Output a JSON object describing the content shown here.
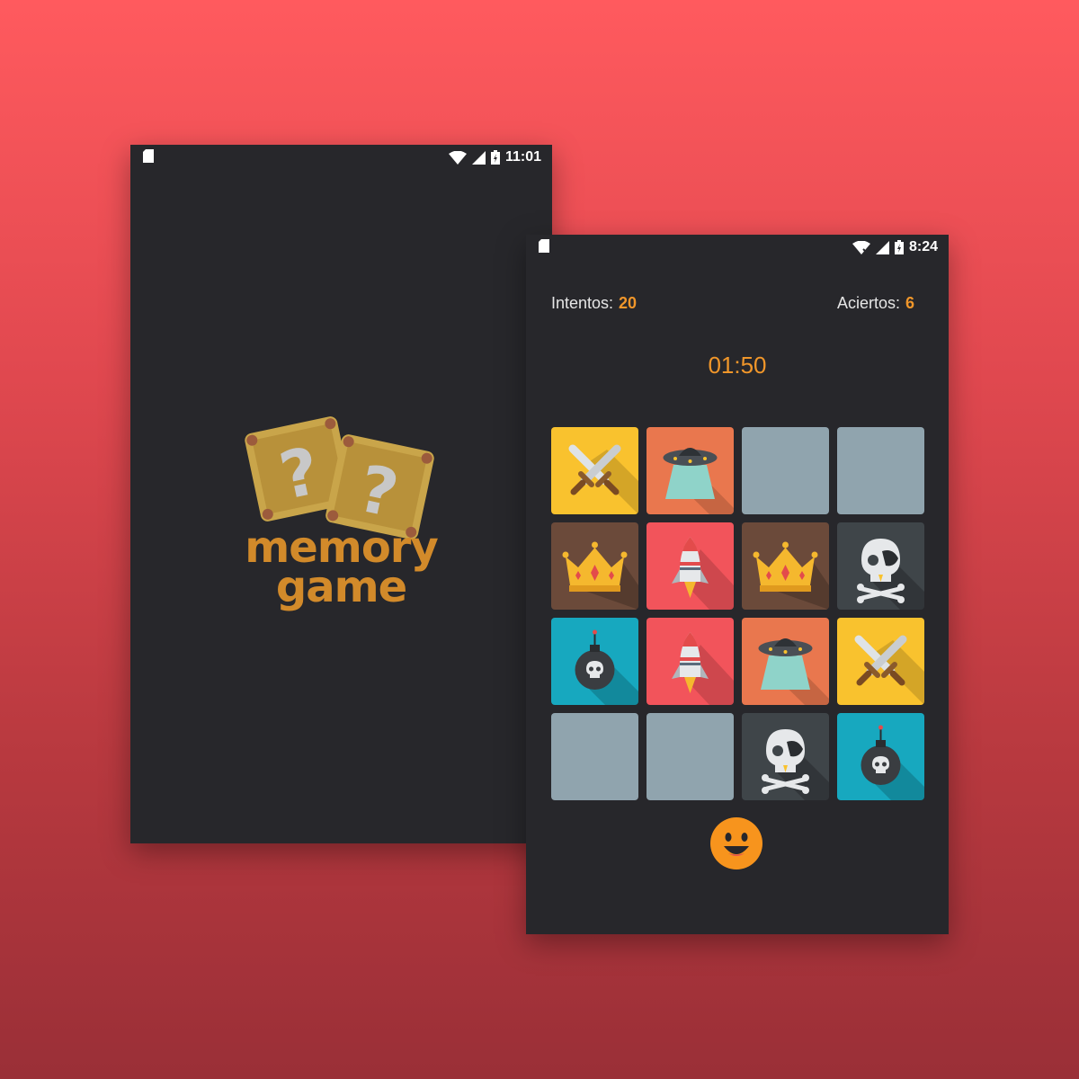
{
  "splash": {
    "status_time": "11:01",
    "logo_line1": "memory",
    "logo_line2": "game"
  },
  "game": {
    "status_time": "8:24",
    "attempts_label": "Intentos:",
    "attempts_value": "20",
    "hits_label": "Aciertos:",
    "hits_value": "6",
    "timer": "01:50",
    "cards": [
      {
        "state": "revealed",
        "icon": "swords-icon",
        "color": "#f9c22e"
      },
      {
        "state": "revealed",
        "icon": "ufo-icon",
        "color": "#e9774e"
      },
      {
        "state": "hidden",
        "icon": "",
        "color": "#90a4ae"
      },
      {
        "state": "hidden",
        "icon": "",
        "color": "#90a4ae"
      },
      {
        "state": "revealed",
        "icon": "crown-icon",
        "color": "#6b4a3a"
      },
      {
        "state": "revealed",
        "icon": "rocket-icon",
        "color": "#f2545b"
      },
      {
        "state": "revealed",
        "icon": "crown-icon",
        "color": "#6b4a3a"
      },
      {
        "state": "revealed",
        "icon": "pirate-skull-icon",
        "color": "#3f4549"
      },
      {
        "state": "revealed",
        "icon": "bomb-icon",
        "color": "#17a8bf"
      },
      {
        "state": "revealed",
        "icon": "rocket-icon",
        "color": "#f2545b"
      },
      {
        "state": "revealed",
        "icon": "ufo-icon",
        "color": "#e9774e"
      },
      {
        "state": "revealed",
        "icon": "swords-icon",
        "color": "#f9c22e"
      },
      {
        "state": "hidden",
        "icon": "",
        "color": "#90a4ae"
      },
      {
        "state": "hidden",
        "icon": "",
        "color": "#90a4ae"
      },
      {
        "state": "revealed",
        "icon": "pirate-skull-icon",
        "color": "#3f4549"
      },
      {
        "state": "revealed",
        "icon": "bomb-icon",
        "color": "#17a8bf"
      }
    ],
    "face_icon": "smiley-face-icon"
  },
  "colors": {
    "accent": "#f0962a",
    "phone_bg": "#27272b",
    "hidden_card": "#90a4ae"
  }
}
